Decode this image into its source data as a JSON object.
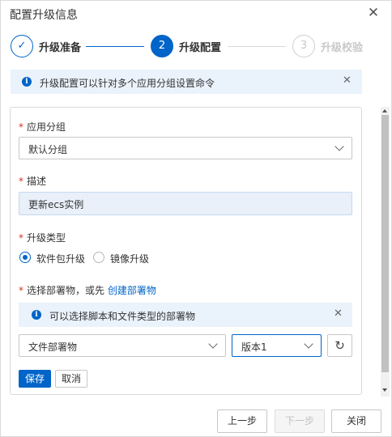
{
  "dialog": {
    "title": "配置升级信息"
  },
  "steps": [
    {
      "number": "✓",
      "label": "升级准备",
      "state": "done"
    },
    {
      "number": "2",
      "label": "升级配置",
      "state": "active"
    },
    {
      "number": "3",
      "label": "升级校验",
      "state": "pending"
    }
  ],
  "top_alert": {
    "text": "升级配置可以针对多个应用分组设置命令"
  },
  "form": {
    "app_group": {
      "label": "应用分组",
      "value": "默认分组"
    },
    "description": {
      "label": "描述",
      "value": "更新ecs实例"
    },
    "upgrade_type": {
      "label": "升级类型",
      "options": [
        "软件包升级",
        "镜像升级"
      ],
      "selected": "软件包升级"
    },
    "deploy": {
      "label": "选择部署物，或先",
      "link": "创建部署物",
      "alert": "可以选择脚本和文件类型的部署物",
      "artifact_value": "文件部署物",
      "version_value": "版本1"
    },
    "save_label": "保存",
    "cancel_label": "取消"
  },
  "footer": {
    "prev_label": "上一步",
    "next_label": "下一步",
    "close_label": "关闭"
  },
  "colors": {
    "primary": "#0064c8",
    "alert_bg": "#eaf2fb",
    "required": "#d93026"
  }
}
